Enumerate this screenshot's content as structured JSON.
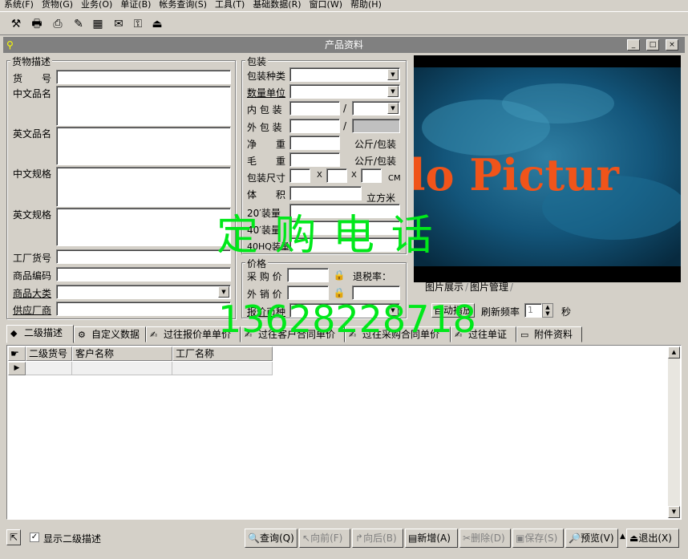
{
  "menu": [
    "系统(F)",
    "货物(G)",
    "业务(O)",
    "单证(B)",
    "帐务查询(S)",
    "工具(T)",
    "基础数据(R)",
    "窗口(W)",
    "帮助(H)"
  ],
  "window": {
    "title": "产品资料"
  },
  "goods_desc": {
    "title": "货物描述",
    "item_no": "货　　号",
    "cn_name": "中文品名",
    "en_name": "英文品名",
    "cn_spec": "中文规格",
    "en_spec": "英文规格",
    "factory_no": "工厂货号",
    "product_code": "商品编码",
    "category": "商品大类",
    "supplier": "供应厂商"
  },
  "packing": {
    "title": "包装",
    "type": "包装种类",
    "qty_unit": "数量单位",
    "inner": "内 包 装",
    "outer": "外 包 装",
    "net": "净　　重",
    "gross": "毛　　重",
    "kg_per_pack_1": "公斤/包装",
    "kg_per_pack_2": "公斤/包装",
    "size": "包装尺寸",
    "x1": "X",
    "x2": "X",
    "cm": "CM",
    "volume": "体　　积",
    "cbm": "立方米",
    "load20": "20′装量",
    "load40": "40′装量",
    "load40hq": "40HQ装量",
    "slash1": "/",
    "slash2": "/"
  },
  "price": {
    "title": "价格",
    "purchase": "采 购 价",
    "sale": "外 销 价",
    "tax_refund": "退税率：",
    "quote_currency": "报价币种"
  },
  "photo": {
    "text": "lo Pictur",
    "tab_show": "图片展示",
    "tab_manage": "图片管理",
    "auto_play": "自动播放",
    "refresh_rate": "刷新频率",
    "refresh_value": "1",
    "seconds": "秒"
  },
  "tabs": [
    "二级描述",
    "自定义数据",
    "过往报价单单价",
    "过往客户合同单价",
    "过往采购合同单价",
    "过往单证",
    "附件资料"
  ],
  "grid": {
    "columns": [
      "二级货号",
      "客户名称",
      "工厂名称"
    ]
  },
  "bottom": {
    "show_secondary": "显示二级描述",
    "query": "查询(Q)",
    "prev": "向前(F)",
    "next": "向后(B)",
    "add": "新增(A)",
    "delete": "删除(D)",
    "save": "保存(S)",
    "preview": "预览(V)",
    "exit": "退出(X)"
  },
  "watermark": {
    "line1": "定 购 电 话",
    "line2": "13628228718"
  }
}
